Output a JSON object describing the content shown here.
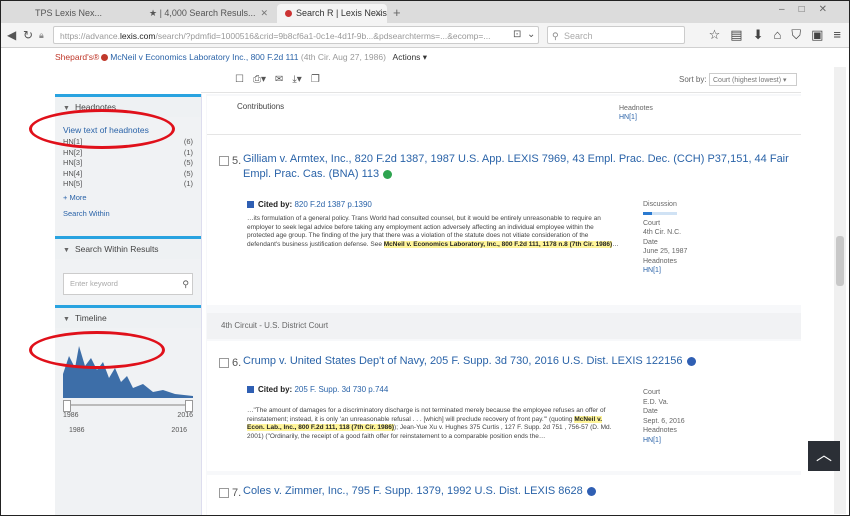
{
  "browser": {
    "tabs": [
      {
        "label": "TPS Lexis Nex..."
      },
      {
        "label": "★ | 4,000 Search Resuls..."
      },
      {
        "label": "Search R | Lexis Nexis ®"
      }
    ],
    "url_prefix": "https://advance.",
    "url_domain": "lexis.com",
    "url_rest": "/search/?pdmfid=1000516&crid=9b8cf6a1-0c1e-4d1f-9b...&pdsearchterms=...&ecomp=...",
    "search_placeholder": "Search",
    "back_icon": "back-arrow-icon",
    "reload_icon": "reload-icon"
  },
  "breadcrumb": {
    "app": "Shepard's®",
    "case": "McNeil v Economics Laboratory Inc., 800 F.2d 111",
    "court": "(4th Cir. Aug 27, 1986)",
    "action": "Actions ▾"
  },
  "toolbar": {
    "sort_label": "Sort by:",
    "sort_value": "Court (highest lowest) ▾"
  },
  "sidebar": {
    "headnotes_header": "Headnotes",
    "view_full_text": "View text of headnotes",
    "headnotes": [
      {
        "label": "HN[1]",
        "count": "(6)"
      },
      {
        "label": "HN[2]",
        "count": "(1)"
      },
      {
        "label": "HN[3]",
        "count": "(5)"
      },
      {
        "label": "HN[4]",
        "count": "(5)"
      },
      {
        "label": "HN[5]",
        "count": "(1)"
      }
    ],
    "more_label": "+ More",
    "narrow_label": "Search Within",
    "search_within_header": "Search Within Results",
    "search_within_placeholder": "Enter keyword",
    "timeline_header": "Timeline",
    "timeline_start": "1986",
    "timeline_end": "2016",
    "btn_start": "1986",
    "btn_end": "2016"
  },
  "main": {
    "top_stub_left": "Contributions",
    "top_stub_right_label": "Headnotes",
    "top_stub_right_link": "HN[1]",
    "results": [
      {
        "num": "5.",
        "title": "Gilliam v. Armtex, Inc.",
        "citation": ", 820 F.2d 1387, 1987 U.S. App. LEXIS 7969, 43 Empl. Prac. Dec. (CCH) P37,151, 44 Fair Empl. Prac. Cas. (BNA) 113",
        "signal_color": "#2ea44f",
        "cited_prefix": "Cited by:",
        "cited_text": " 820 F.2d 1387 p.1390",
        "snippet_1": "…its formulation of a general policy. Trans World had consulted counsel, but it would be entirely unreasonable to require an employer to seek legal advice before taking any employment action adversely affecting an individual employee within the protected age group. The finding of the jury that there was a violation of the statute does not vitiate consideration of the defendant's business justification defense. See ",
        "snippet_hl": "McNeil v. Economics Laboratory, Inc., 800 F.2d 111, 1178 n.8 (7th Cir. 1986)",
        "snippet_2": "…",
        "meta_label_1": "Discussion",
        "meta_label_2": "Court",
        "meta_val_2": "4th Cir. N.C.",
        "meta_label_3": "Date",
        "meta_val_3": "June 25, 1987",
        "meta_label_4": "Headnotes",
        "meta_val_4": "HN[1]"
      },
      {
        "num": "6.",
        "title": "Crump v. United States Dep't of Navy",
        "citation": ", 205 F. Supp. 3d 730, 2016 U.S. Dist. LEXIS 122156",
        "signal_color": "#2f5fb3",
        "cited_prefix": "Cited by:",
        "cited_text": " 205 F. Supp. 3d 730 p.744",
        "snippet_1": "…\"The amount of damages for a discriminatory discharge is not terminated merely because the employee refuses an offer of reinstatement; instead, it is only 'an unreasonable refusal . . . [which] will preclude recovery of front pay.'\" (quoting ",
        "snippet_hl": "McNeil v. Econ. Lab., Inc., 800 F.2d 111, 118 (7th Cir. 1986)",
        "snippet_2": "); Jean-Yue Xu v. Hughes 375 Curtis , 127 F. Supp. 2d 751 , 756-57 (D. Md. 2001) (\"Ordinarily, the receipt of a good faith offer for reinstatement to a comparable position ends the…",
        "meta_label_2": "Court",
        "meta_val_2": "E.D. Va.",
        "meta_label_3": "Date",
        "meta_val_3": "Sept. 6, 2016",
        "meta_label_4": "Headnotes",
        "meta_val_4": "HN[1]"
      },
      {
        "num": "7.",
        "title": "Coles v. Zimmer, Inc.",
        "citation": ", 795 F. Supp. 1379, 1992 U.S. Dist. LEXIS 8628",
        "signal_color": "#2f5fb3"
      }
    ],
    "separator": "4th Circuit - U.S. District Court"
  }
}
